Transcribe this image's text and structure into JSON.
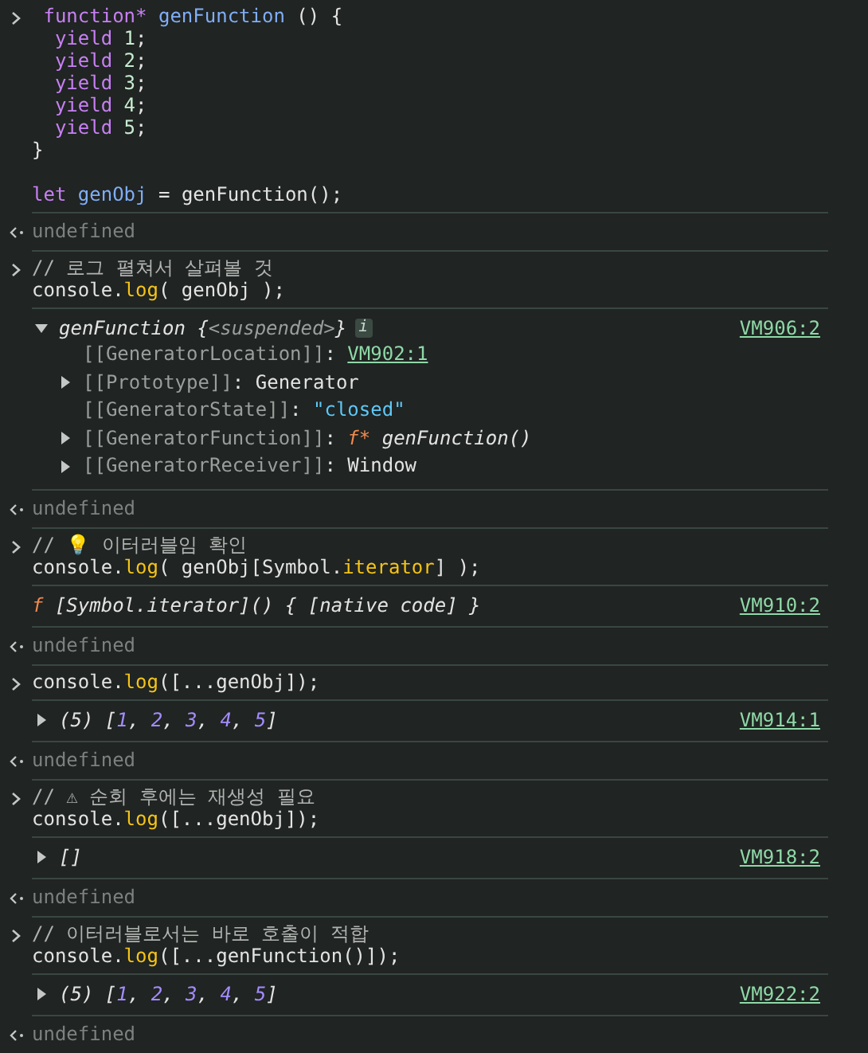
{
  "entries": [
    {
      "kind": "input",
      "lines": [
        {
          "tokens": [
            {
              "kind": "keyword",
              "text": " function*"
            },
            {
              "kind": "def",
              "text": " genFunction"
            },
            {
              "kind": "plain",
              "text": " () {"
            }
          ]
        },
        {
          "tokens": [
            {
              "kind": "keyword",
              "text": "  yield"
            },
            {
              "kind": "number",
              "text": " 1"
            },
            {
              "kind": "plain",
              "text": ";"
            }
          ]
        },
        {
          "tokens": [
            {
              "kind": "keyword",
              "text": "  yield"
            },
            {
              "kind": "number",
              "text": " 2"
            },
            {
              "kind": "plain",
              "text": ";"
            }
          ]
        },
        {
          "tokens": [
            {
              "kind": "keyword",
              "text": "  yield"
            },
            {
              "kind": "number",
              "text": " 3"
            },
            {
              "kind": "plain",
              "text": ";"
            }
          ]
        },
        {
          "tokens": [
            {
              "kind": "keyword",
              "text": "  yield"
            },
            {
              "kind": "number",
              "text": " 4"
            },
            {
              "kind": "plain",
              "text": ";"
            }
          ]
        },
        {
          "tokens": [
            {
              "kind": "keyword",
              "text": "  yield"
            },
            {
              "kind": "number",
              "text": " 5"
            },
            {
              "kind": "plain",
              "text": ";"
            }
          ]
        },
        {
          "tokens": [
            {
              "kind": "plain",
              "text": "}"
            }
          ]
        },
        {
          "spaced": true,
          "tokens": [
            {
              "kind": "keyword",
              "text": "let"
            },
            {
              "kind": "def",
              "text": " genObj"
            },
            {
              "kind": "plain",
              "text": " = genFunction();"
            }
          ]
        }
      ]
    },
    {
      "kind": "result",
      "text": "undefined"
    },
    {
      "kind": "input",
      "lines": [
        {
          "tokens": [
            {
              "kind": "comment",
              "text": "// 로그 펼쳐서 살펴볼 것"
            }
          ]
        },
        {
          "tokens": [
            {
              "kind": "plain",
              "text": "console."
            },
            {
              "kind": "method",
              "text": "log"
            },
            {
              "kind": "plain",
              "text": "( genObj );"
            }
          ]
        }
      ]
    },
    {
      "kind": "output",
      "expanded": true,
      "tokens": [
        {
          "kind": "italic",
          "text": "genFunction {"
        },
        {
          "kind": "placeholder",
          "text": "<suspended>"
        },
        {
          "kind": "italic",
          "text": "}"
        },
        {
          "kind": "badge",
          "text": "i"
        }
      ],
      "link": "VM906:2",
      "children": [
        {
          "tokens": [
            {
              "kind": "propkey",
              "text": "[[GeneratorLocation]]"
            },
            {
              "kind": "plain",
              "text": ": "
            },
            {
              "kind": "link",
              "text": "VM902:1"
            }
          ]
        },
        {
          "expanded": false,
          "tokens": [
            {
              "kind": "propkey",
              "text": "[[Prototype]]"
            },
            {
              "kind": "plain",
              "text": ": Generator"
            }
          ]
        },
        {
          "tokens": [
            {
              "kind": "propkey",
              "text": "[[GeneratorState]]"
            },
            {
              "kind": "plain",
              "text": ": "
            },
            {
              "kind": "string",
              "text": "\"closed\""
            }
          ]
        },
        {
          "expanded": false,
          "tokens": [
            {
              "kind": "propkey",
              "text": "[[GeneratorFunction]]"
            },
            {
              "kind": "plain",
              "text": ": "
            },
            {
              "kind": "fnprefix",
              "text": "f*"
            },
            {
              "kind": "italic",
              "text": " genFunction()"
            }
          ]
        },
        {
          "expanded": false,
          "tokens": [
            {
              "kind": "propkey",
              "text": "[[GeneratorReceiver]]"
            },
            {
              "kind": "plain",
              "text": ": Window"
            }
          ]
        }
      ]
    },
    {
      "kind": "result",
      "text": "undefined"
    },
    {
      "kind": "input",
      "lines": [
        {
          "tokens": [
            {
              "kind": "comment",
              "text": "// 💡 이터러블임 확인"
            }
          ]
        },
        {
          "tokens": [
            {
              "kind": "plain",
              "text": "console."
            },
            {
              "kind": "method",
              "text": "log"
            },
            {
              "kind": "plain",
              "text": "( genObj[Symbol."
            },
            {
              "kind": "method",
              "text": "iterator"
            },
            {
              "kind": "plain",
              "text": "] );"
            }
          ]
        }
      ]
    },
    {
      "kind": "output",
      "tokens": [
        {
          "kind": "fnprefix",
          "text": "f"
        },
        {
          "kind": "italic",
          "text": " [Symbol.iterator]() { [native code] }"
        }
      ],
      "link": "VM910:2"
    },
    {
      "kind": "result",
      "text": "undefined"
    },
    {
      "kind": "input",
      "lines": [
        {
          "tokens": [
            {
              "kind": "plain",
              "text": "console."
            },
            {
              "kind": "method",
              "text": "log"
            },
            {
              "kind": "plain",
              "text": "([...genObj]);"
            }
          ]
        }
      ]
    },
    {
      "kind": "output",
      "expanded": false,
      "tokens": [
        {
          "kind": "italic",
          "text": "(5) ["
        },
        {
          "kind": "arraynum",
          "text": "1"
        },
        {
          "kind": "italic",
          "text": ", "
        },
        {
          "kind": "arraynum",
          "text": "2"
        },
        {
          "kind": "italic",
          "text": ", "
        },
        {
          "kind": "arraynum",
          "text": "3"
        },
        {
          "kind": "italic",
          "text": ", "
        },
        {
          "kind": "arraynum",
          "text": "4"
        },
        {
          "kind": "italic",
          "text": ", "
        },
        {
          "kind": "arraynum",
          "text": "5"
        },
        {
          "kind": "italic",
          "text": "]"
        }
      ],
      "link": "VM914:1"
    },
    {
      "kind": "result",
      "text": "undefined"
    },
    {
      "kind": "input",
      "lines": [
        {
          "tokens": [
            {
              "kind": "comment",
              "text": "// ⚠ 순회 후에는 재생성 필요"
            }
          ]
        },
        {
          "tokens": [
            {
              "kind": "plain",
              "text": "console."
            },
            {
              "kind": "method",
              "text": "log"
            },
            {
              "kind": "plain",
              "text": "([...genObj]);"
            }
          ]
        }
      ]
    },
    {
      "kind": "output",
      "expanded": false,
      "tokens": [
        {
          "kind": "italic",
          "text": "[]"
        }
      ],
      "link": "VM918:2"
    },
    {
      "kind": "result",
      "text": "undefined"
    },
    {
      "kind": "input",
      "lines": [
        {
          "tokens": [
            {
              "kind": "comment",
              "text": "// 이터러블로서는 바로 호출이 적합"
            }
          ]
        },
        {
          "tokens": [
            {
              "kind": "plain",
              "text": "console."
            },
            {
              "kind": "method",
              "text": "log"
            },
            {
              "kind": "plain",
              "text": "([...genFunction()]);"
            }
          ]
        }
      ]
    },
    {
      "kind": "output",
      "expanded": false,
      "tokens": [
        {
          "kind": "italic",
          "text": "(5) ["
        },
        {
          "kind": "arraynum",
          "text": "1"
        },
        {
          "kind": "italic",
          "text": ", "
        },
        {
          "kind": "arraynum",
          "text": "2"
        },
        {
          "kind": "italic",
          "text": ", "
        },
        {
          "kind": "arraynum",
          "text": "3"
        },
        {
          "kind": "italic",
          "text": ", "
        },
        {
          "kind": "arraynum",
          "text": "4"
        },
        {
          "kind": "italic",
          "text": ", "
        },
        {
          "kind": "arraynum",
          "text": "5"
        },
        {
          "kind": "italic",
          "text": "]"
        }
      ],
      "link": "VM922:2"
    },
    {
      "kind": "result",
      "text": "undefined"
    }
  ]
}
